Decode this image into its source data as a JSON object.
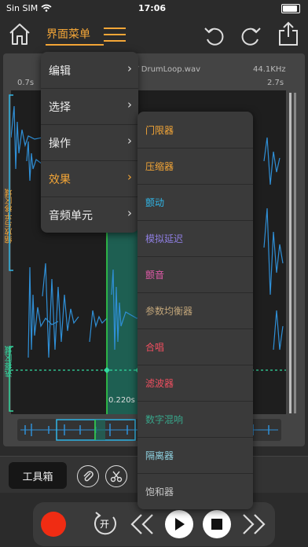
{
  "status": {
    "carrier": "Sin SIM",
    "time": "17:06"
  },
  "header": {
    "menu_label": "界面菜单"
  },
  "editor": {
    "filename": "ry / DrumLoop.wav",
    "sample_rate": "44.1KHz",
    "time_start": "0.7s",
    "time_end": "2.7s",
    "selection_time": "0.220s",
    "zoom_label": "缩放与平移区域",
    "select_label": "选择区域"
  },
  "toolbar": {
    "toolbox_label": "工具箱"
  },
  "transport": {
    "loop_label": "开"
  },
  "main_menu": {
    "items": [
      {
        "label": "编辑"
      },
      {
        "label": "选择"
      },
      {
        "label": "操作"
      },
      {
        "label": "效果",
        "active": true
      },
      {
        "label": "音频单元"
      }
    ]
  },
  "effects_menu": {
    "items": [
      {
        "label": "门限器",
        "color": "#f4a637"
      },
      {
        "label": "压缩器",
        "color": "#f4a637"
      },
      {
        "label": "颤动",
        "color": "#31b6e7"
      },
      {
        "label": "模拟延迟",
        "color": "#8e7ee0"
      },
      {
        "label": "颤音",
        "color": "#e05aa8"
      },
      {
        "label": "参数均衡器",
        "color": "#c2a67a"
      },
      {
        "label": "合唱",
        "color": "#ef4f60"
      },
      {
        "label": "滤波器",
        "color": "#ef4f60"
      },
      {
        "label": "数字混响",
        "color": "#38a58a"
      },
      {
        "label": "隔离器",
        "color": "#8fd1e0"
      },
      {
        "label": "饱和器",
        "color": "#c6c6c6"
      }
    ]
  },
  "colors": {
    "accent": "#f4a637",
    "selection": "#33d94a",
    "waveform": "#2f8fd6",
    "record": "#f02c13"
  }
}
